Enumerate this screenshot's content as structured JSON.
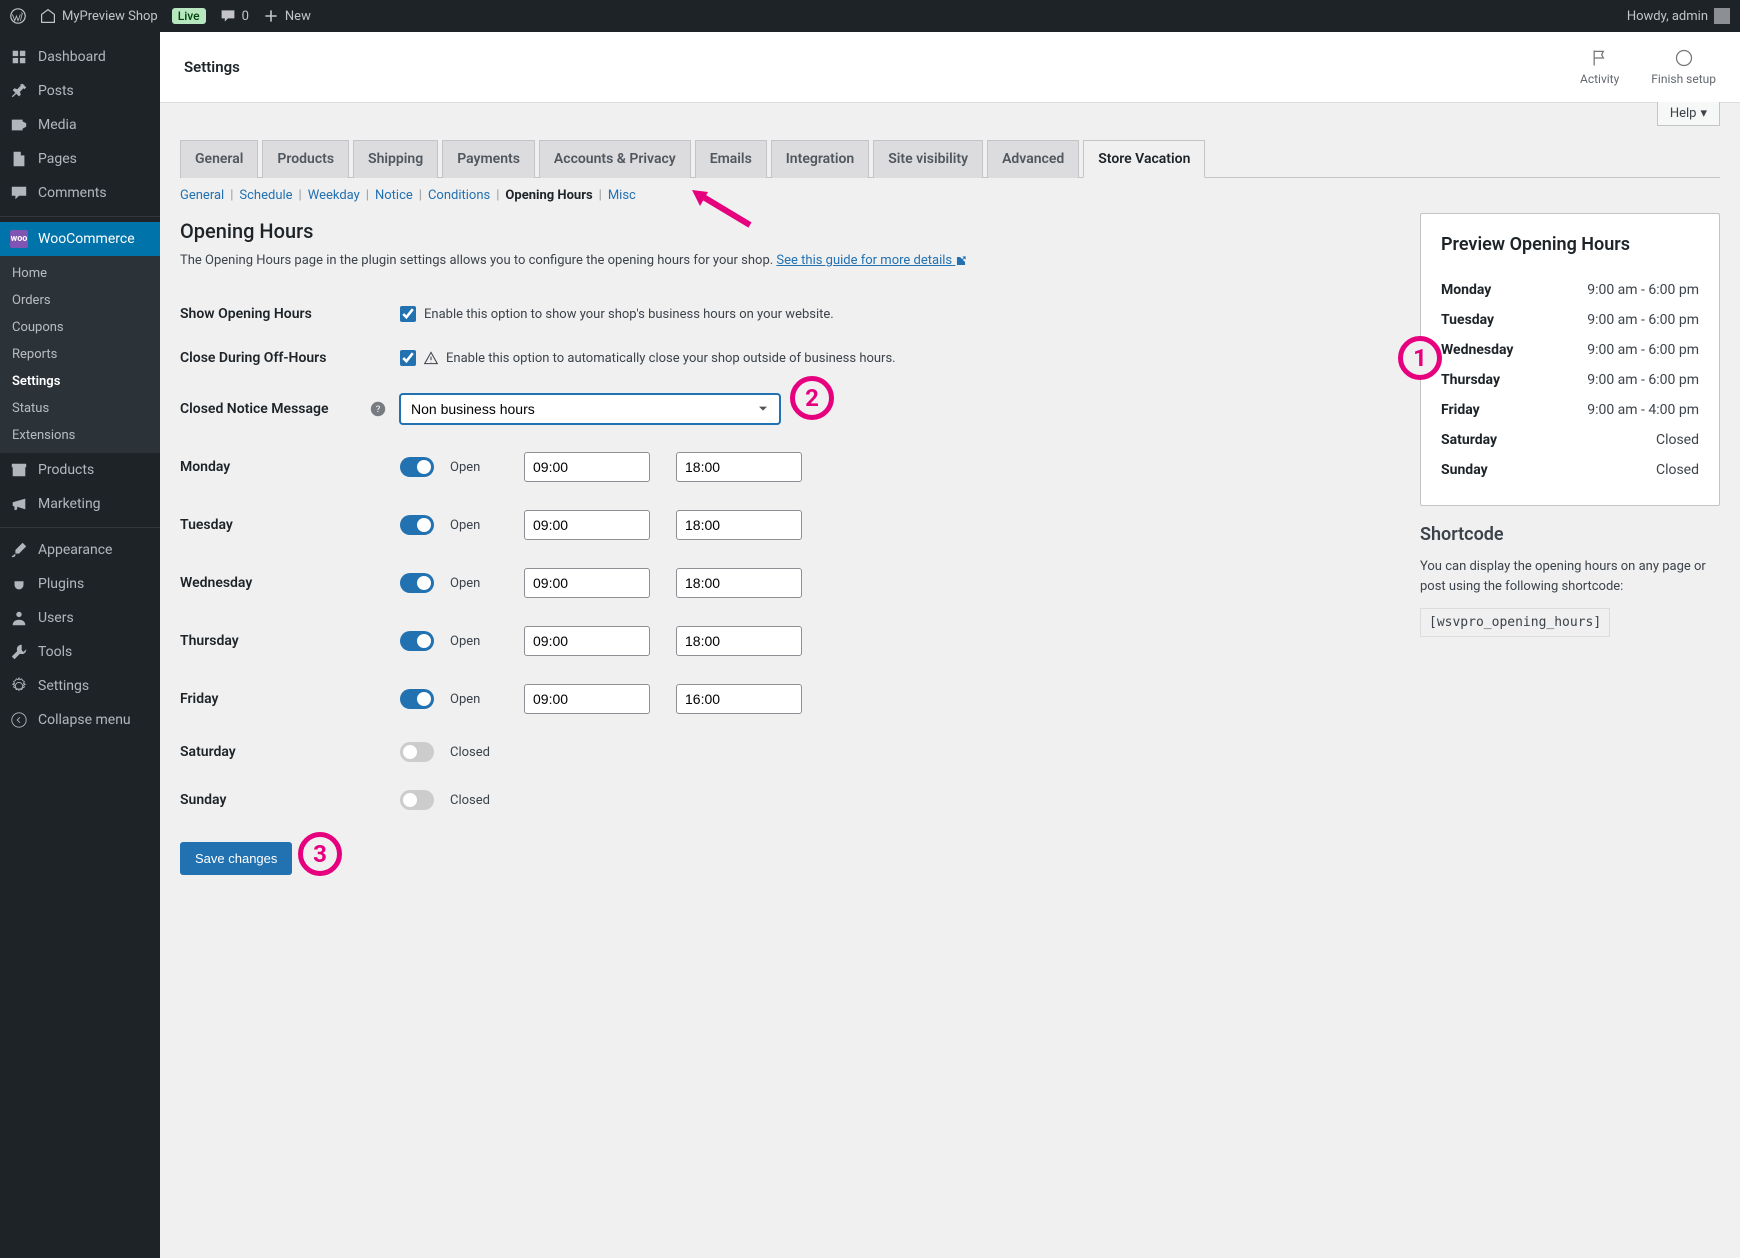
{
  "adminbar": {
    "site": "MyPreview Shop",
    "live": "Live",
    "comments": "0",
    "new": "New",
    "howdy": "Howdy, admin"
  },
  "sidebar": {
    "items": [
      {
        "label": "Dashboard",
        "icon": "dash"
      },
      {
        "label": "Posts",
        "icon": "pin"
      },
      {
        "label": "Media",
        "icon": "media"
      },
      {
        "label": "Pages",
        "icon": "page"
      },
      {
        "label": "Comments",
        "icon": "comment"
      },
      {
        "label": "WooCommerce",
        "icon": "woo",
        "current": true
      },
      {
        "label": "Products",
        "icon": "archive"
      },
      {
        "label": "Marketing",
        "icon": "mega"
      },
      {
        "label": "Appearance",
        "icon": "brush"
      },
      {
        "label": "Plugins",
        "icon": "plug"
      },
      {
        "label": "Users",
        "icon": "user"
      },
      {
        "label": "Tools",
        "icon": "tool"
      },
      {
        "label": "Settings",
        "icon": "gear"
      },
      {
        "label": "Collapse menu",
        "icon": "collapse"
      }
    ],
    "submenu": [
      "Home",
      "Orders",
      "Coupons",
      "Reports",
      "Settings",
      "Status",
      "Extensions"
    ],
    "submenu_current": "Settings"
  },
  "header": {
    "title": "Settings",
    "activity": "Activity",
    "finish": "Finish setup"
  },
  "help": "Help",
  "main_tabs": [
    "General",
    "Products",
    "Shipping",
    "Payments",
    "Accounts & Privacy",
    "Emails",
    "Integration",
    "Site visibility",
    "Advanced",
    "Store Vacation"
  ],
  "main_tab_active": "Store Vacation",
  "sub_tabs": [
    "General",
    "Schedule",
    "Weekday",
    "Notice",
    "Conditions",
    "Opening Hours",
    "Misc"
  ],
  "sub_tab_active": "Opening Hours",
  "page": {
    "title": "Opening Hours",
    "desc": "The Opening Hours page in the plugin settings allows you to configure the opening hours for your shop.",
    "desc_link": "See this guide for more details"
  },
  "fields": {
    "show": {
      "label": "Show Opening Hours",
      "text": "Enable this option to show your shop's business hours on your website."
    },
    "close": {
      "label": "Close During Off-Hours",
      "text": "Enable this option to automatically close your shop outside of business hours."
    },
    "notice": {
      "label": "Closed Notice Message",
      "value": "Non business hours"
    }
  },
  "days": [
    {
      "name": "Monday",
      "open": true,
      "from": "09:00",
      "to": "18:00"
    },
    {
      "name": "Tuesday",
      "open": true,
      "from": "09:00",
      "to": "18:00"
    },
    {
      "name": "Wednesday",
      "open": true,
      "from": "09:00",
      "to": "18:00"
    },
    {
      "name": "Thursday",
      "open": true,
      "from": "09:00",
      "to": "18:00"
    },
    {
      "name": "Friday",
      "open": true,
      "from": "09:00",
      "to": "16:00"
    },
    {
      "name": "Saturday",
      "open": false
    },
    {
      "name": "Sunday",
      "open": false
    }
  ],
  "open_label": "Open",
  "closed_label": "Closed",
  "save": "Save changes",
  "preview": {
    "title": "Preview Opening Hours",
    "rows": [
      {
        "day": "Monday",
        "hours": "9:00 am - 6:00 pm"
      },
      {
        "day": "Tuesday",
        "hours": "9:00 am - 6:00 pm"
      },
      {
        "day": "Wednesday",
        "hours": "9:00 am - 6:00 pm"
      },
      {
        "day": "Thursday",
        "hours": "9:00 am - 6:00 pm"
      },
      {
        "day": "Friday",
        "hours": "9:00 am - 4:00 pm"
      },
      {
        "day": "Saturday",
        "hours": "Closed"
      },
      {
        "day": "Sunday",
        "hours": "Closed"
      }
    ]
  },
  "shortcode": {
    "title": "Shortcode",
    "desc": "You can display the opening hours on any page or post using the following shortcode:",
    "code": "[wsvpro_opening_hours]"
  }
}
